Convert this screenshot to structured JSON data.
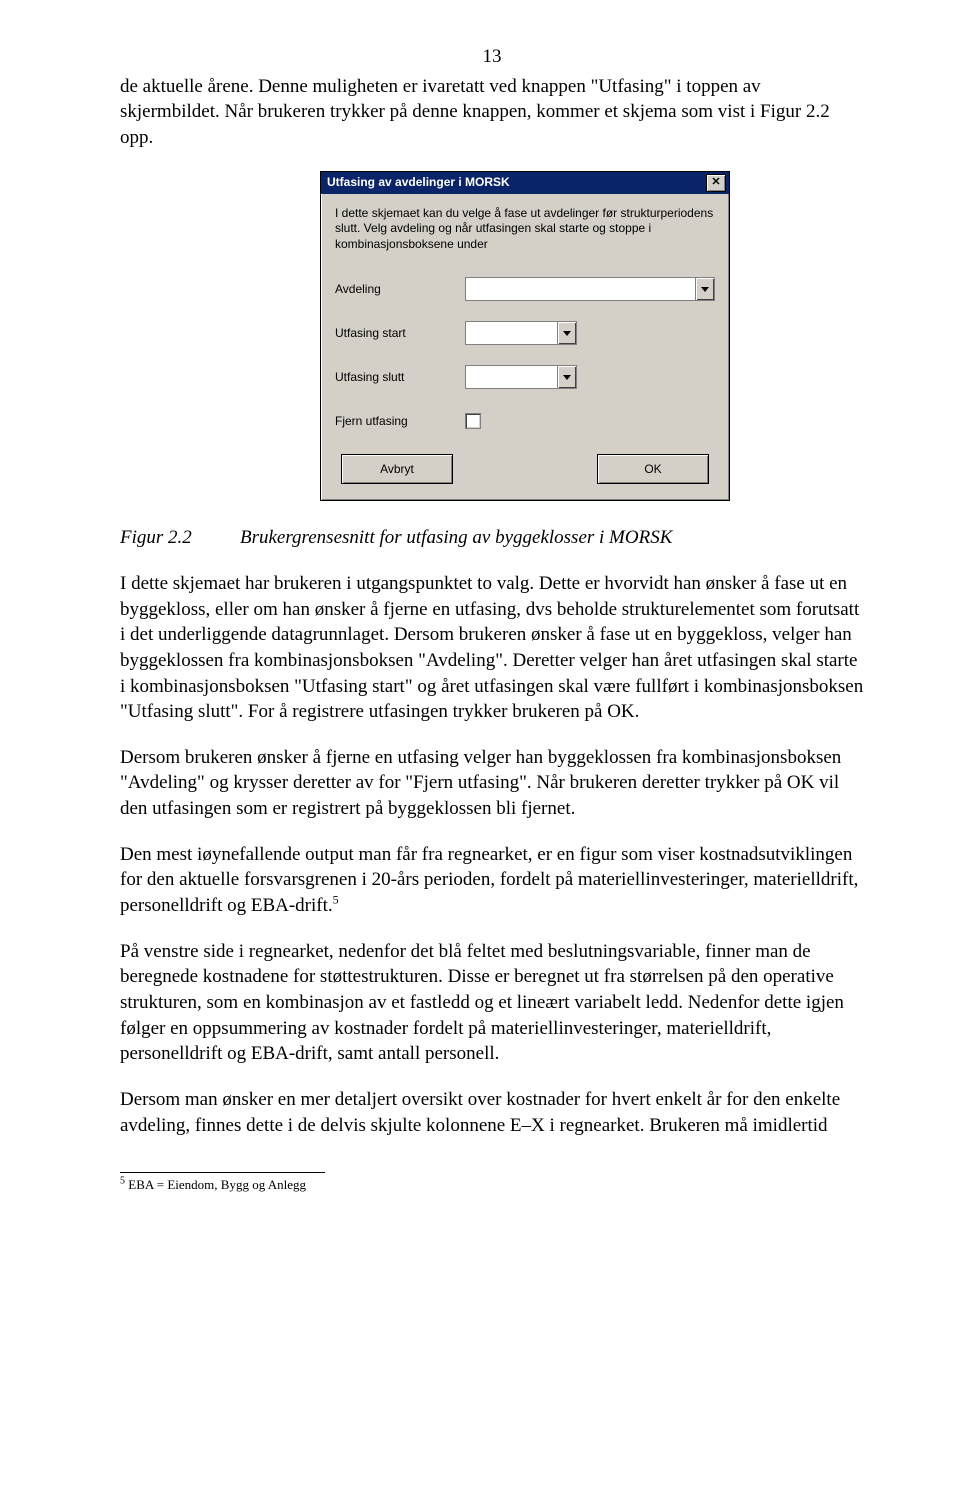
{
  "page_number": "13",
  "para1": "de aktuelle årene. Denne muligheten er ivaretatt ved knappen \"Utfasing\" i toppen av skjermbildet. Når brukeren trykker på denne knappen, kommer et skjema som vist i Figur 2.2 opp.",
  "dialog": {
    "title": "Utfasing av avdelinger i MORSK",
    "close_symbol": "✕",
    "intro": "I dette skjemaet kan du velge å fase ut avdelinger før strukturperiodens slutt. Velg avdeling og når utfasingen skal starte og stoppe i kombinasjonsboksene under",
    "labels": {
      "avdeling": "Avdeling",
      "utfasing_start": "Utfasing start",
      "utfasing_slutt": "Utfasing slutt",
      "fjern_utfasing": "Fjern utfasing"
    },
    "buttons": {
      "cancel": "Avbryt",
      "ok": "OK"
    }
  },
  "figure": {
    "label": "Figur 2.2",
    "text": "Brukergrensesnitt for utfasing av byggeklosser i MORSK"
  },
  "para2": "I dette skjemaet har brukeren i utgangspunktet to valg. Dette er hvorvidt han ønsker å fase ut en byggekloss, eller om han ønsker å fjerne en utfasing, dvs beholde strukturelementet som forutsatt i det underliggende datagrunnlaget. Dersom brukeren ønsker å fase ut en byggekloss, velger han byggeklossen fra kombinasjonsboksen \"Avdeling\". Deretter velger han året utfasingen skal starte i kombinasjonsboksen \"Utfasing start\" og året utfasingen skal være fullført i kombinasjonsboksen \"Utfasing slutt\". For å registrere utfasingen trykker brukeren på OK.",
  "para3": "Dersom brukeren ønsker å fjerne en utfasing velger han byggeklossen fra kombinasjonsboksen \"Avdeling\" og krysser deretter av for \"Fjern utfasing\". Når brukeren deretter trykker på OK vil den utfasingen som er registrert på byggeklossen bli fjernet.",
  "para4_a": "Den mest iøynefallende output man får fra regnearket, er en figur som viser kostnadsutviklingen for den aktuelle forsvarsgrenen i 20-års perioden, fordelt på materiellinvesteringer, materielldrift, personelldrift og EBA-drift.",
  "para4_sup": "5",
  "para5": "På venstre side i regnearket, nedenfor det blå feltet med beslutningsvariable, finner man de beregnede kostnadene for støttestrukturen. Disse er beregnet ut fra størrelsen på den operative strukturen, som en kombinasjon av et fastledd og et lineært variabelt ledd. Nedenfor dette igjen følger en oppsummering av kostnader fordelt på materiellinvesteringer, materielldrift, personelldrift og EBA-drift, samt antall personell.",
  "para6": "Dersom man ønsker en mer detaljert oversikt over kostnader for hvert enkelt år for den enkelte avdeling, finnes dette i de delvis skjulte kolonnene E–X i regnearket. Brukeren må imidlertid",
  "footnote": {
    "num": "5",
    "text": " EBA = Eiendom, Bygg og Anlegg"
  }
}
